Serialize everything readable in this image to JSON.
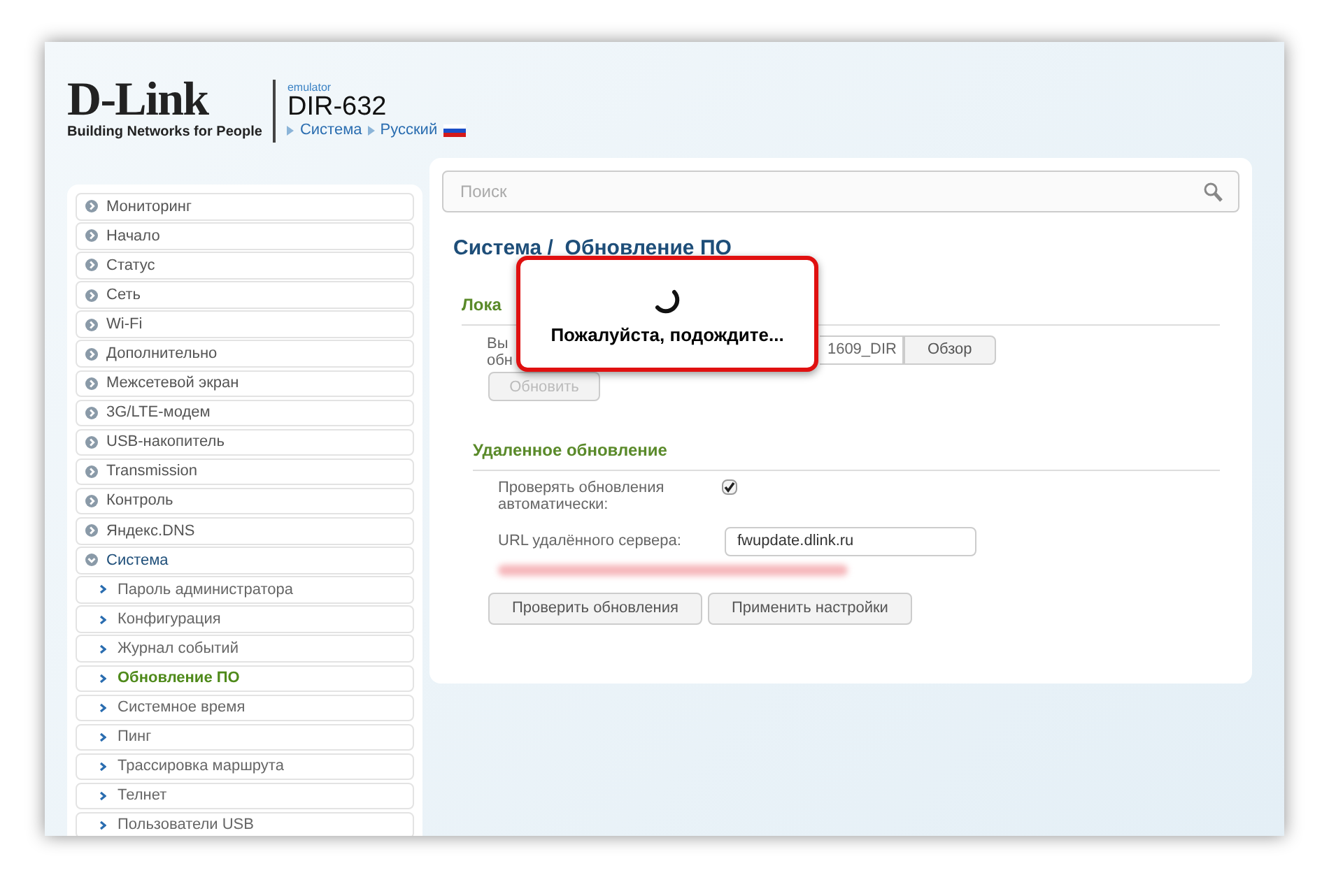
{
  "header": {
    "logo": "D-Link",
    "tagline": "Building Networks for People",
    "subtitle": "emulator",
    "model": "DIR-632",
    "breadcrumb": [
      "Система",
      "Русский"
    ]
  },
  "sidebar": {
    "items": [
      {
        "label": "Мониторинг",
        "expanded": false,
        "selected": false
      },
      {
        "label": "Начало",
        "expanded": false,
        "selected": false
      },
      {
        "label": "Статус",
        "expanded": false,
        "selected": false
      },
      {
        "label": "Сеть",
        "expanded": false,
        "selected": false
      },
      {
        "label": "Wi-Fi",
        "expanded": false,
        "selected": false
      },
      {
        "label": "Дополнительно",
        "expanded": false,
        "selected": false
      },
      {
        "label": "Межсетевой экран",
        "expanded": false,
        "selected": false
      },
      {
        "label": "3G/LTE-модем",
        "expanded": false,
        "selected": false
      },
      {
        "label": "USB-накопитель",
        "expanded": false,
        "selected": false
      },
      {
        "label": "Transmission",
        "expanded": false,
        "selected": false
      },
      {
        "label": "Контроль",
        "expanded": false,
        "selected": false
      },
      {
        "label": "Яндекс.DNS",
        "expanded": false,
        "selected": false
      },
      {
        "label": "Система",
        "expanded": true,
        "selected": true,
        "children": [
          {
            "label": "Пароль администратора",
            "selected": false
          },
          {
            "label": "Конфигурация",
            "selected": false
          },
          {
            "label": "Журнал событий",
            "selected": false
          },
          {
            "label": "Обновление ПО",
            "selected": true
          },
          {
            "label": "Системное время",
            "selected": false
          },
          {
            "label": "Пинг",
            "selected": false
          },
          {
            "label": "Трассировка маршрута",
            "selected": false
          },
          {
            "label": "Телнет",
            "selected": false
          },
          {
            "label": "Пользователи USB",
            "selected": false
          }
        ]
      }
    ]
  },
  "search": {
    "placeholder": "Поиск"
  },
  "page_title": "Система /  Обновление ПО",
  "local_update": {
    "title": "Лока",
    "file_label_lines": [
      "Вы",
      "обн"
    ],
    "file_value": "1609_DIR",
    "browse_button": "Обзор",
    "update_button": "Обновить",
    "update_disabled": true
  },
  "remote_update": {
    "title": "Удаленное обновление",
    "auto_check_label": "Проверять обновления автоматически:",
    "auto_check": true,
    "url_label": "URL удалённого сервера:",
    "url_value": "fwupdate.dlink.ru",
    "buttons": [
      "Проверить обновления",
      "Применить настройки"
    ]
  },
  "overlay": {
    "message": "Пожалуйста, подождите..."
  }
}
